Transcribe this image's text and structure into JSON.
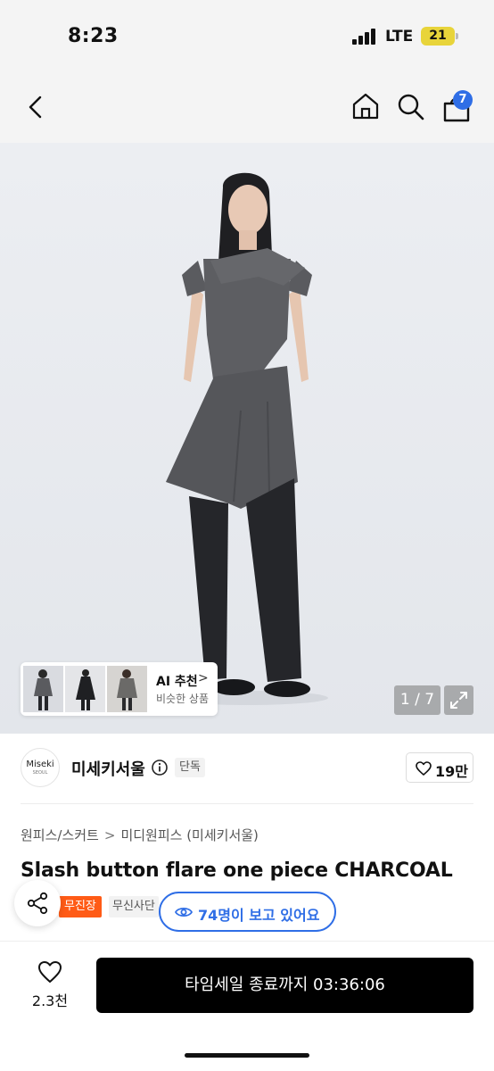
{
  "status": {
    "time": "8:23",
    "network": "LTE",
    "battery": "21"
  },
  "header": {
    "cart_count": "7",
    "icons": [
      "back-icon",
      "home-icon",
      "search-icon",
      "cart-icon"
    ]
  },
  "gallery": {
    "page_counter": "1 / 7",
    "ai_title": "AI 추천",
    "ai_chevron": ">",
    "ai_subtitle": "비슷한 상품"
  },
  "brand": {
    "logo_text": "Miseki",
    "logo_sub": "SEOUL",
    "name": "미세키서울",
    "exclusive_badge": "단독",
    "like_count": "19만"
  },
  "breadcrumb": {
    "items": [
      "원피스/스커트",
      "미디원피스 (미세키서울)"
    ],
    "separator": ">"
  },
  "product": {
    "title": "Slash button flare one piece CHARCOAL"
  },
  "tags": {
    "store": "무진장",
    "partial": "무신사단"
  },
  "viewers": {
    "text": "74명이 보고 있어요"
  },
  "bottom": {
    "wish_count": "2.3천",
    "buy_label": "타임세일 종료까지 03:36:06"
  },
  "colors": {
    "accent": "#2f6ee6",
    "orange": "#ff5b16",
    "button": "#000000"
  }
}
